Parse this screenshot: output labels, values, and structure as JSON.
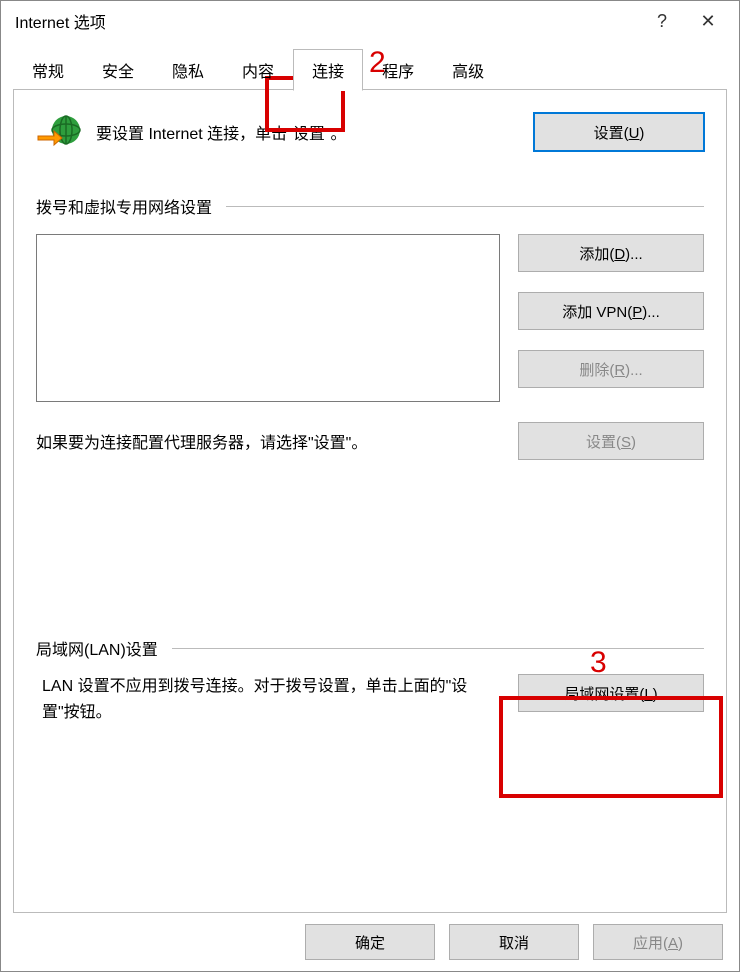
{
  "window": {
    "title": "Internet 选项",
    "help": "?",
    "close": "✕"
  },
  "tabs": [
    "常规",
    "安全",
    "隐私",
    "内容",
    "连接",
    "程序",
    "高级"
  ],
  "selected_tab": 4,
  "setup": {
    "text": "要设置 Internet 连接，单击\"设置\"。",
    "button": "设置(U)"
  },
  "dial": {
    "label": "拨号和虚拟专用网络设置",
    "add": "添加(D)...",
    "add_vpn": "添加 VPN(P)...",
    "remove": "删除(R)...",
    "proxy_text": "如果要为连接配置代理服务器，请选择\"设置\"。",
    "settings": "设置(S)"
  },
  "lan": {
    "label": "局域网(LAN)设置",
    "text": "LAN 设置不应用到拨号连接。对于拨号设置，单击上面的\"设置\"按钮。",
    "button": "局域网设置(L)"
  },
  "footer": {
    "ok": "确定",
    "cancel": "取消",
    "apply": "应用(A)"
  },
  "annotations": {
    "num2": "2",
    "num3": "3"
  }
}
